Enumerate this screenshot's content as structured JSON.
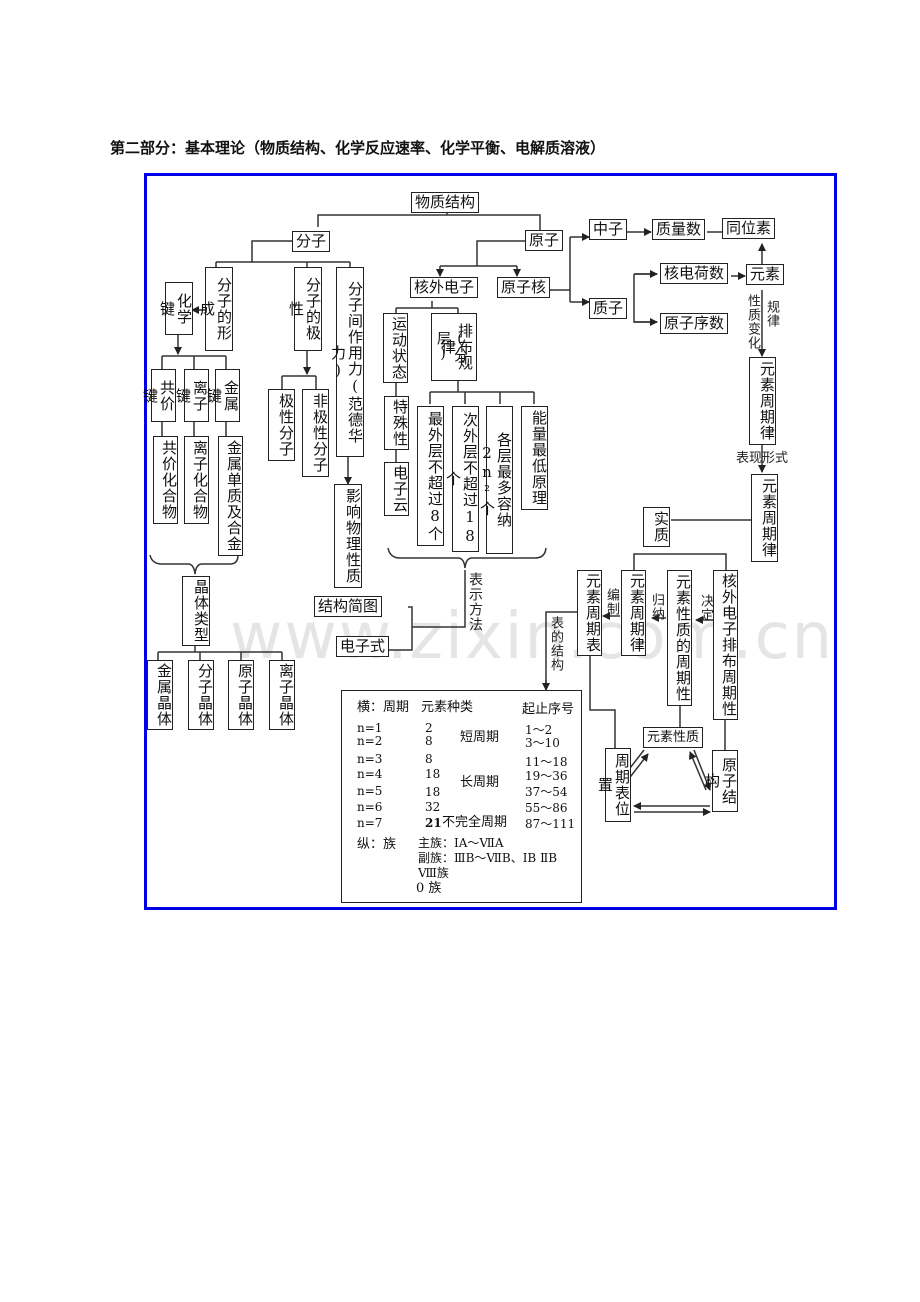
{
  "heading": "第二部分：基本理论（物质结构、化学反应速率、化学平衡、电解质溶液）",
  "watermark": "www.zixin.com.cn",
  "frame_color": "#0000e6",
  "nodes": {
    "wuzhi_jiegou": "物质结构",
    "fenzi": "分子",
    "yuanzi": "原子",
    "fenzi_xingcheng": "分子的形成",
    "fenzi_jixing": "分子的极性",
    "fenzi_zuoyongli": "分子间作用力(范德华力)",
    "huaxue_jian": "化学键",
    "gongjia_jian": "共价键",
    "lizi_jian": "离子键",
    "jinshu_jian": "金属键",
    "gongjia_huahewu": "共价化合物",
    "lizi_huahewu": "离子化合物",
    "jinshu_danzhi": "金属单质及合金",
    "jixing_fenzi": "极性分子",
    "feijixing_fenzi": "非极性分子",
    "yingxiang": "影响物理性质",
    "jingti_leixing": "晶体类型",
    "jinshu_jingti": "金属晶体",
    "fenzi_jingti": "分子晶体",
    "yuanzi_jingti": "原子晶体",
    "lizi_jingti": "离子晶体",
    "hewai_dianzi": "核外电子",
    "yuanzihe": "原子核",
    "yundong_zhuangtai": "运动状态",
    "fenceng": "(分层)",
    "paibu_guilv": "排布规律",
    "teshu_xing": "特殊性",
    "dianzi_yun": "电子云",
    "zuiwaiceng": "最外层不超过8个",
    "ciwaiceng": "次外层不超过18个",
    "geceng": "各层最多容纳2n²个",
    "nengliang": "能量最低原理",
    "jiegou_jiantu": "结构简图",
    "dianzi_shi": "电子式",
    "zhongzi": "中子",
    "zhiliang_shu": "质量数",
    "tongwei_su": "同位素",
    "zhizi": "质子",
    "hedianhe_shu": "核电荷数",
    "yuanzi_xushu": "原子序数",
    "yuansu": "元素",
    "yuansu_zhouqilv_1": "元素周期律",
    "yuansu_zhouqilv_2": "元素周期律",
    "shizhi": "实质",
    "yuansu_zhouqibiao": "元素周期表",
    "yuansu_zhouqilv_3": "元素周期律",
    "yuansu_xingzhi_zhouqi": "元素性质的周期性",
    "hewai_paibu_zhouqi": "核外电子排布周期性",
    "yuansu_xingzhi": "元素性质",
    "zhouqibiao_weizhi": "周期表位置",
    "yuanzi_jiegou": "原子结构"
  },
  "labels": {
    "xingzhi_bianhua": "性质变化",
    "guilv": "规律",
    "biaoxian_xingshi": "表现形式",
    "biaoshi_fangfa": "表示方法",
    "bianzhi": "编制",
    "guina": "归纳",
    "jueding": "决定",
    "biao_de_jiegou": "表的结构"
  },
  "table": {
    "header_period": "横：周期",
    "header_kinds": "元素种类",
    "header_range": "起止序号",
    "rows": [
      {
        "n": "n=1",
        "kinds": "2",
        "range": "1～2"
      },
      {
        "n": "n=2",
        "kinds": "8",
        "range": "3～10"
      },
      {
        "n": "n=3",
        "kinds": "8",
        "range": "11～18"
      },
      {
        "n": "n=4",
        "kinds": "18",
        "range": "19～36"
      },
      {
        "n": "n=5",
        "kinds": "18",
        "range": "37～54"
      },
      {
        "n": "n=6",
        "kinds": "32",
        "range": "55～86"
      },
      {
        "n": "n=7",
        "kinds": "21",
        "range": "87～111"
      }
    ],
    "short_period": "短周期",
    "long_period": "长周期",
    "incomplete_period": "不完全周期",
    "group_label": "纵：族",
    "main_group": "主族：ⅠA～ⅦA",
    "sub_group": "副族：ⅢB～ⅦB、ⅠB ⅡB",
    "group_viii": "Ⅷ族",
    "group_zero": "0 族"
  }
}
